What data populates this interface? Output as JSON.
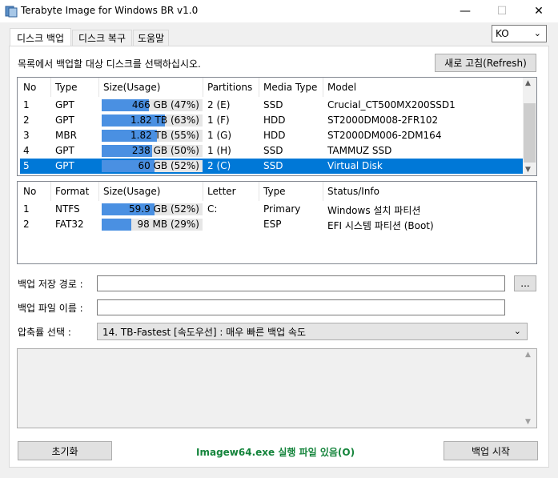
{
  "window": {
    "title": "Terabyte Image for Windows BR v1.0"
  },
  "tabs": [
    {
      "label": "디스크 백업",
      "active": true
    },
    {
      "label": "디스크 복구",
      "active": false
    },
    {
      "label": "도움말",
      "active": false
    }
  ],
  "language": {
    "selected": "KO"
  },
  "instruction": "목록에서 백업할 대상 디스크를 선택하십시오.",
  "refresh_label": "새로 고침(Refresh)",
  "disks": {
    "headers": [
      "No",
      "Type",
      "Size(Usage)",
      "Partitions",
      "Media Type",
      "Model"
    ],
    "rows": [
      {
        "no": "1",
        "type": "GPT",
        "size": "466 GB",
        "pct_label": "(47%)",
        "usage": 0.47,
        "partitions": "2 (E)",
        "media": "SSD",
        "model": "Crucial_CT500MX200SSD1"
      },
      {
        "no": "2",
        "type": "GPT",
        "size": "1.82 TB",
        "pct_label": "(63%)",
        "usage": 0.63,
        "partitions": "1 (F)",
        "media": "HDD",
        "model": "ST2000DM008-2FR102"
      },
      {
        "no": "3",
        "type": "MBR",
        "size": "1.82 TB",
        "pct_label": "(55%)",
        "usage": 0.55,
        "partitions": "1 (G)",
        "media": "HDD",
        "model": "ST2000DM006-2DM164"
      },
      {
        "no": "4",
        "type": "GPT",
        "size": "238 GB",
        "pct_label": "(50%)",
        "usage": 0.5,
        "partitions": "1 (H)",
        "media": "SSD",
        "model": "TAMMUZ SSD"
      },
      {
        "no": "5",
        "type": "GPT",
        "size": "60 GB",
        "pct_label": "(52%)",
        "usage": 0.52,
        "partitions": "2 (C)",
        "media": "SSD",
        "model": "Virtual Disk",
        "selected": true
      }
    ]
  },
  "partitions": {
    "headers": [
      "No",
      "Format",
      "Size(Usage)",
      "Letter",
      "Type",
      "Status/Info"
    ],
    "rows": [
      {
        "no": "1",
        "format": "NTFS",
        "size": "59.9 GB",
        "pct_label": "(52%)",
        "usage": 0.52,
        "letter": "C:",
        "type": "Primary",
        "info": "Windows 설치 파티션"
      },
      {
        "no": "2",
        "format": "FAT32",
        "size": "98 MB",
        "pct_label": "(29%)",
        "usage": 0.29,
        "letter": "",
        "type": "ESP",
        "info": "EFI 시스템 파티션 (Boot)"
      }
    ]
  },
  "form": {
    "backup_path_label": "백업 저장 경로 :",
    "backup_path_value": "",
    "browse_label": "...",
    "backup_name_label": "백업 파일 이름 :",
    "backup_name_value": "",
    "compression_label": "압축률 선택 :",
    "compression_value": "14. TB-Fastest [속도우선] : 매우 빠른 백업 속도"
  },
  "log_text": "",
  "footer": {
    "reset_label": "초기화",
    "status": "Imagew64.exe 실행 파일 있음(O)",
    "start_label": "백업 시작"
  },
  "colors": {
    "selection": "#0078d7",
    "usage_fill": "#4a90e2",
    "status_green": "#14843b"
  }
}
